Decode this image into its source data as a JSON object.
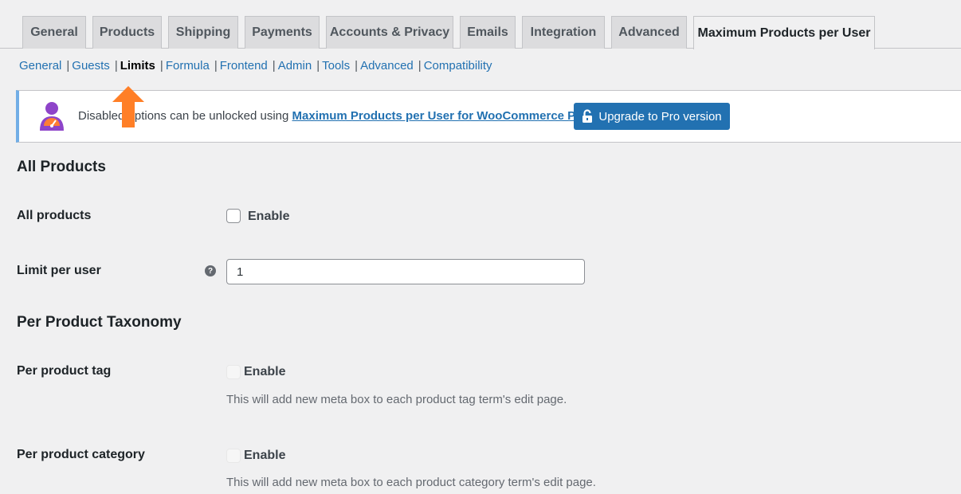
{
  "tabs": [
    {
      "label": "General"
    },
    {
      "label": "Products"
    },
    {
      "label": "Shipping"
    },
    {
      "label": "Payments"
    },
    {
      "label": "Accounts & Privacy"
    },
    {
      "label": "Emails"
    },
    {
      "label": "Integration"
    },
    {
      "label": "Advanced"
    },
    {
      "label": "Maximum Products per User",
      "active": true
    }
  ],
  "subnav": [
    {
      "label": "General"
    },
    {
      "label": "Guests"
    },
    {
      "label": "Limits",
      "current": true
    },
    {
      "label": "Formula"
    },
    {
      "label": "Frontend"
    },
    {
      "label": "Admin"
    },
    {
      "label": "Tools"
    },
    {
      "label": "Advanced"
    },
    {
      "label": "Compatibility"
    }
  ],
  "subnav_separator": "|",
  "notice": {
    "text": "Disabled options can be unlocked using",
    "link": "Maximum Products per User for WooCommerce Pro",
    "button": "Upgrade to Pro version",
    "icon": "plugin-mascot-icon",
    "button_icon": "unlock-icon"
  },
  "sections": {
    "all_products": {
      "title": "All Products",
      "all_products_label": "All products",
      "enable_label": "Enable",
      "enable_checked": false,
      "limit_label": "Limit per user",
      "limit_value": "1",
      "help_glyph": "?"
    },
    "taxonomy": {
      "title": "Per Product Taxonomy",
      "tag_label": "Per product tag",
      "tag_enable": "Enable",
      "tag_desc": "This will add new meta box to each product tag term's edit page.",
      "category_label": "Per product category",
      "category_enable": "Enable",
      "category_desc": "This will add new meta box to each product category term's edit page."
    }
  },
  "colors": {
    "accent": "#2271b1",
    "highlight_arrow": "#ff7f27",
    "background": "#f0f0f1"
  }
}
